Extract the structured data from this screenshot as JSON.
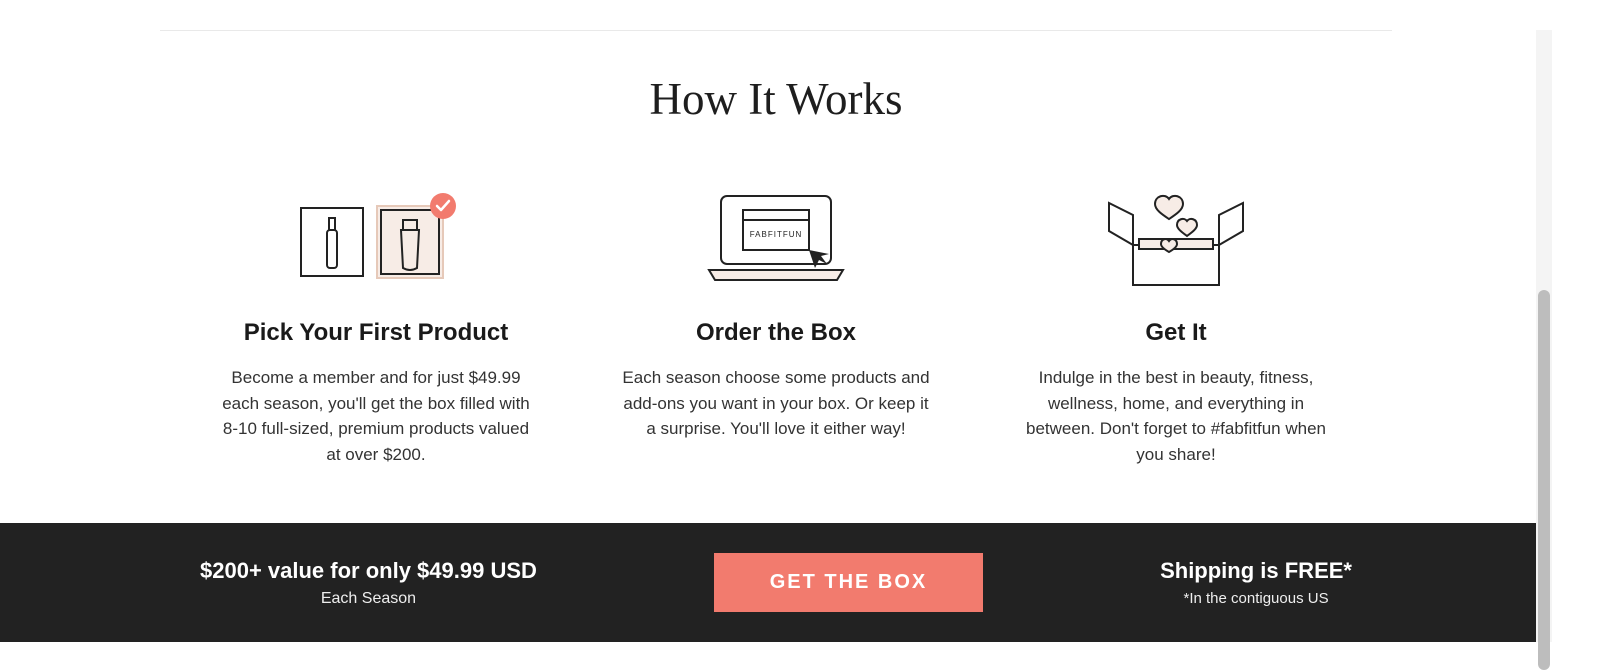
{
  "section_title": "How It Works",
  "steps": [
    {
      "title": "Pick Your First Product",
      "desc": "Become a member and for just $49.99 each season, you'll get the box filled with 8-10 full-sized, premium products valued at over $200.",
      "icon": "pick-product-icon"
    },
    {
      "title": "Order the Box",
      "desc": "Each season choose some products and add-ons you want in your box. Or keep it a surprise. You'll love it either way!",
      "icon": "laptop-box-icon",
      "icon_text": "FABFITFUN"
    },
    {
      "title": "Get It",
      "desc": "Indulge in the best in beauty, fitness, wellness, home, and everything in between. Don't forget to #fabfitfun when you share!",
      "icon": "open-box-hearts-icon"
    }
  ],
  "cta": {
    "left_headline": "$200+ value for only $49.99 USD",
    "left_sub": "Each Season",
    "button_label": "GET THE BOX",
    "right_headline": "Shipping is FREE*",
    "right_sub": "*In the contiguous US"
  },
  "colors": {
    "accent": "#f27b6e",
    "dark_bar": "#222222"
  }
}
